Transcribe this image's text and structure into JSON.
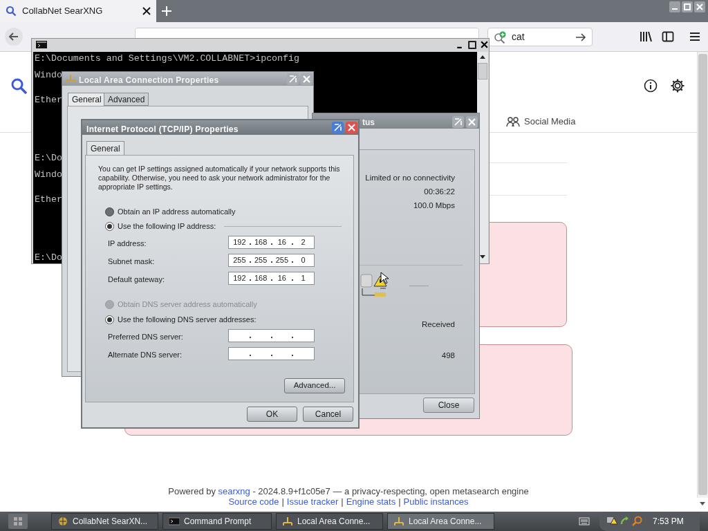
{
  "browser": {
    "tab": {
      "title": "CollabNet SearXNG",
      "selected": true
    },
    "search_box": {
      "value": "cat"
    },
    "categories": [
      {
        "label": "Social Media",
        "selected": false
      }
    ],
    "footer": {
      "prefix": "Powered by",
      "link": "searxng",
      "suffix": "- 2024.8.9+f1c05e7 — a privacy-respecting, open metasearch engine",
      "links": [
        "Source code",
        "Issue tracker",
        "Engine stats",
        "Public instances"
      ],
      "separator": "|"
    }
  },
  "command_prompt": {
    "lines": [
      "E:\\Documents and Settings\\VM2.COLLABNET>ipconfig",
      "Windo",
      "Ether",
      "E:\\Do",
      "Windo",
      "Ether",
      "E:\\Do"
    ]
  },
  "lan_properties": {
    "title": "Local Area Connection Properties",
    "tabs": [
      {
        "label": "General",
        "selected": true
      },
      {
        "label": "Advanced",
        "selected": false
      }
    ]
  },
  "status_window": {
    "title": "tus",
    "status": "Limited or no connectivity",
    "duration": "00:36:22",
    "speed": "100.0 Mbps",
    "activity_label": "Received",
    "received": "498",
    "close_button": "Close"
  },
  "tcpip": {
    "title": "Internet Protocol (TCP/IP) Properties",
    "tabs": [
      {
        "label": "General",
        "selected": true
      }
    ],
    "intro": "You can get IP settings assigned automatically if your network supports this capability. Otherwise, you need to ask your network administrator for the appropriate IP settings.",
    "ip_options": [
      {
        "label": "Obtain an IP address automatically",
        "selected": false,
        "disabled": false
      },
      {
        "label": "Use the following IP address:",
        "selected": true,
        "disabled": false
      }
    ],
    "ip_fields": [
      {
        "label": "IP address:",
        "octets": [
          "192",
          "168",
          "16",
          "2"
        ]
      },
      {
        "label": "Subnet mask:",
        "octets": [
          "255",
          "255",
          "255",
          "0"
        ]
      },
      {
        "label": "Default gateway:",
        "octets": [
          "192",
          "168",
          "16",
          "1"
        ]
      }
    ],
    "dns_options": [
      {
        "label": "Obtain DNS server address automatically",
        "selected": false,
        "disabled": true
      },
      {
        "label": "Use the following DNS server addresses:",
        "selected": true,
        "disabled": false
      }
    ],
    "dns_fields": [
      {
        "label": "Preferred DNS server:"
      },
      {
        "label": "Alternate DNS server:"
      }
    ],
    "advanced_button": "Advanced...",
    "buttons": [
      "OK",
      "Cancel"
    ]
  },
  "taskbar": {
    "items": [
      {
        "label": "CollabNet SearXN...",
        "kind": "browser",
        "selected": false
      },
      {
        "label": "Command Prompt",
        "kind": "console",
        "selected": false
      },
      {
        "label": "Local Area Conne...",
        "kind": "network",
        "selected": false
      },
      {
        "label": "Local Area Conne...",
        "kind": "network",
        "selected": true
      }
    ],
    "clock": "7:53 PM"
  }
}
